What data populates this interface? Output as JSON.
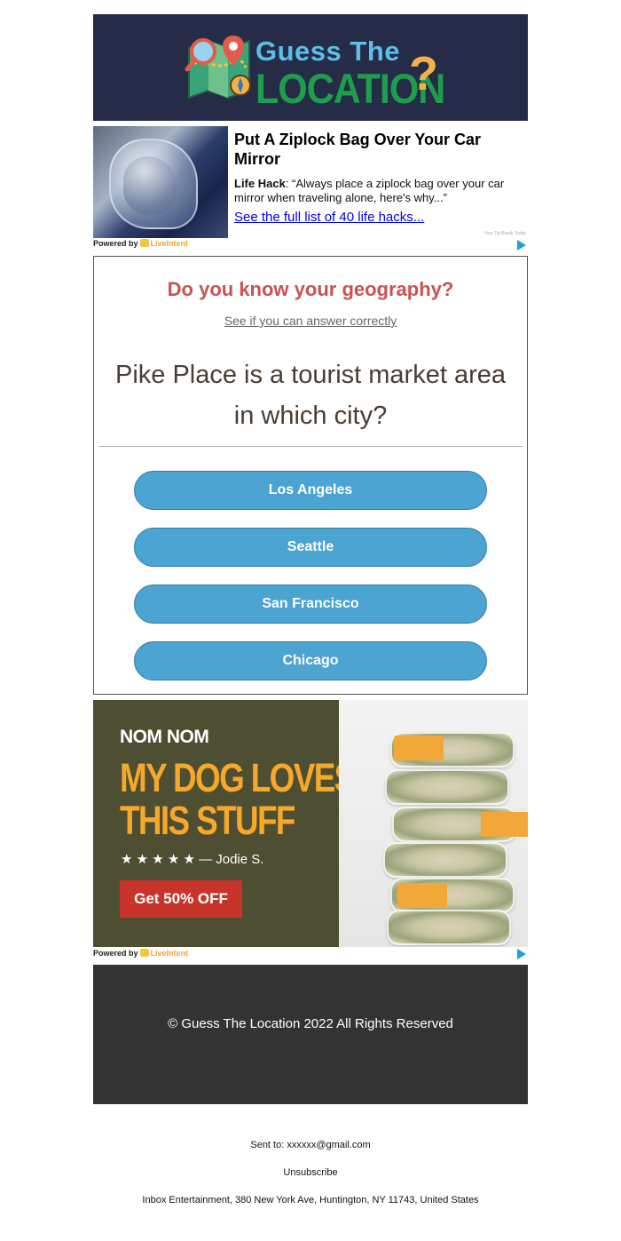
{
  "header": {
    "logo_line1": "Guess The",
    "logo_line2": "LOCATION",
    "logo_mark": "?"
  },
  "ad_top": {
    "title": "Put A Ziplock Bag Over Your Car Mirror",
    "body_bold": "Life Hack",
    "body_text": ": “Always place a ziplock bag over your car mirror when traveling alone, here's why...”",
    "link": "See the full list of 40 life hacks...",
    "credit": "Your Tip Break Today",
    "powered_by": "Powered by",
    "powered_brand": "LiveIntent"
  },
  "quiz": {
    "heading": "Do you know your geography?",
    "subheading": "See if you can answer correctly",
    "question": "Pike Place is a tourist market area in which city?",
    "answers": [
      "Los Angeles",
      "Seattle",
      "San Francisco",
      "Chicago"
    ],
    "button_color": "#4ba4d1",
    "heading_color": "#c9534f"
  },
  "ad_bottom": {
    "brand": "NOM NOM",
    "headline_1": "MY DOG LOVES",
    "headline_2": "THIS STUFF",
    "review": "★ ★ ★ ★ ★  — Jodie S.",
    "cta": "Get 50% OFF",
    "powered_by": "Powered by",
    "powered_brand": "LiveIntent"
  },
  "footer": {
    "copyright": "© Guess The Location 2022 All Rights Reserved"
  },
  "meta": {
    "sent_to": "Sent to: xxxxxx@gmail.com",
    "unsubscribe": "Unsubscribe",
    "address": "Inbox Entertainment, 380 New York Ave, Huntington, NY 11743, United States"
  }
}
